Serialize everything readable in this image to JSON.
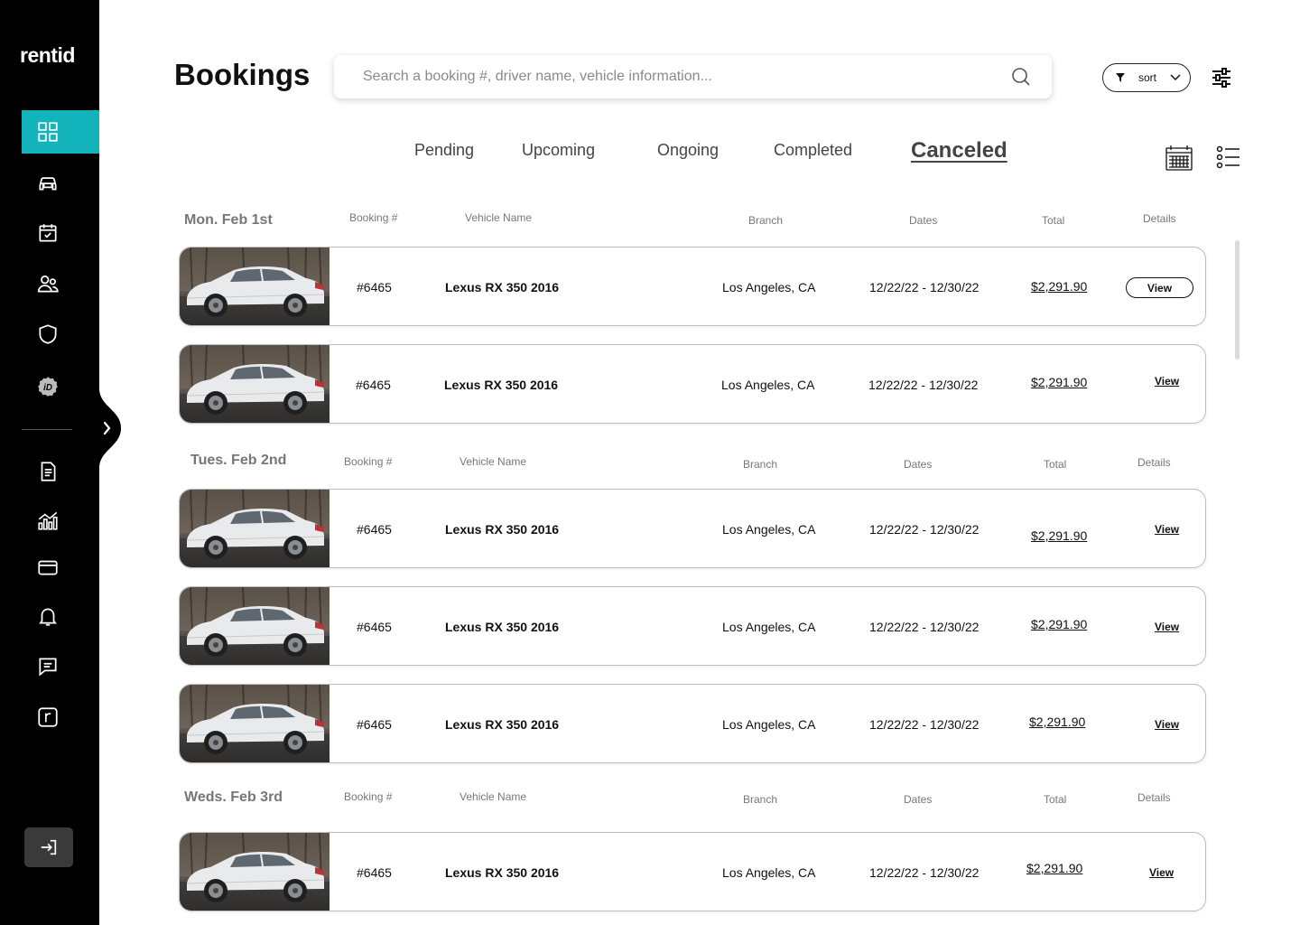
{
  "brand": {
    "logo": "rentid",
    "accent": "#12b3bb"
  },
  "sidebar": {
    "items": [
      {
        "icon": "dashboard-icon",
        "active": true
      },
      {
        "icon": "car-icon"
      },
      {
        "icon": "calendar-check-icon"
      },
      {
        "icon": "users-icon"
      },
      {
        "icon": "shield-icon"
      },
      {
        "icon": "id-badge-icon"
      },
      {
        "icon": "document-icon"
      },
      {
        "icon": "analytics-icon"
      },
      {
        "icon": "card-icon"
      },
      {
        "icon": "bell-icon"
      },
      {
        "icon": "chat-icon"
      },
      {
        "icon": "r-logo-icon"
      }
    ]
  },
  "header": {
    "title": "Bookings",
    "search_placeholder": "Search a booking #, driver name, vehicle information...",
    "sort_label": "sort"
  },
  "tabs": [
    {
      "label": "Pending"
    },
    {
      "label": "Upcoming"
    },
    {
      "label": "Ongoing"
    },
    {
      "label": "Completed"
    },
    {
      "label": "Canceled",
      "active": true
    }
  ],
  "columns": {
    "booking": "Booking #",
    "vehicle": "Vehicle Name",
    "branch": "Branch",
    "dates": "Dates",
    "total": "Total",
    "details": "Details"
  },
  "groups": [
    {
      "date": "Mon. Feb 1st",
      "rows": [
        {
          "booking": "#6465",
          "vehicle": "Lexus RX 350 2016",
          "branch": "Los Angeles, CA",
          "dates": "12/22/22 - 12/30/22",
          "total": "$2,291.90",
          "details": "View"
        },
        {
          "booking": "#6465",
          "vehicle": "Lexus RX 350 2016",
          "branch": "Los Angeles, CA",
          "dates": "12/22/22 - 12/30/22",
          "total": "$2,291.90",
          "details": "View"
        }
      ]
    },
    {
      "date": "Tues. Feb 2nd",
      "rows": [
        {
          "booking": "#6465",
          "vehicle": "Lexus RX 350 2016",
          "branch": "Los Angeles, CA",
          "dates": "12/22/22 - 12/30/22",
          "total": "$2,291.90",
          "details": "View"
        },
        {
          "booking": "#6465",
          "vehicle": "Lexus RX 350 2016",
          "branch": "Los Angeles, CA",
          "dates": "12/22/22 - 12/30/22",
          "total": "$2,291.90",
          "details": "View"
        },
        {
          "booking": "#6465",
          "vehicle": "Lexus RX 350 2016",
          "branch": "Los Angeles, CA",
          "dates": "12/22/22 - 12/30/22",
          "total": "$2,291.90",
          "details": "View"
        }
      ]
    },
    {
      "date": "Weds. Feb 3rd",
      "rows": [
        {
          "booking": "#6465",
          "vehicle": "Lexus RX 350 2016",
          "branch": "Los Angeles, CA",
          "dates": "12/22/22 - 12/30/22",
          "total": "$2,291.90",
          "details": "View"
        }
      ]
    }
  ]
}
